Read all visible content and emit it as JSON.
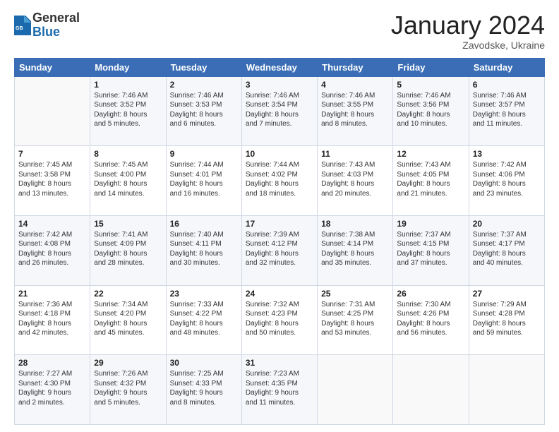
{
  "header": {
    "logo_general": "General",
    "logo_blue": "Blue",
    "month_title": "January 2024",
    "subtitle": "Zavodske, Ukraine"
  },
  "days_of_week": [
    "Sunday",
    "Monday",
    "Tuesday",
    "Wednesday",
    "Thursday",
    "Friday",
    "Saturday"
  ],
  "weeks": [
    [
      {
        "num": "",
        "info": ""
      },
      {
        "num": "1",
        "info": "Sunrise: 7:46 AM\nSunset: 3:52 PM\nDaylight: 8 hours\nand 5 minutes."
      },
      {
        "num": "2",
        "info": "Sunrise: 7:46 AM\nSunset: 3:53 PM\nDaylight: 8 hours\nand 6 minutes."
      },
      {
        "num": "3",
        "info": "Sunrise: 7:46 AM\nSunset: 3:54 PM\nDaylight: 8 hours\nand 7 minutes."
      },
      {
        "num": "4",
        "info": "Sunrise: 7:46 AM\nSunset: 3:55 PM\nDaylight: 8 hours\nand 8 minutes."
      },
      {
        "num": "5",
        "info": "Sunrise: 7:46 AM\nSunset: 3:56 PM\nDaylight: 8 hours\nand 10 minutes."
      },
      {
        "num": "6",
        "info": "Sunrise: 7:46 AM\nSunset: 3:57 PM\nDaylight: 8 hours\nand 11 minutes."
      }
    ],
    [
      {
        "num": "7",
        "info": "Sunrise: 7:45 AM\nSunset: 3:58 PM\nDaylight: 8 hours\nand 13 minutes."
      },
      {
        "num": "8",
        "info": "Sunrise: 7:45 AM\nSunset: 4:00 PM\nDaylight: 8 hours\nand 14 minutes."
      },
      {
        "num": "9",
        "info": "Sunrise: 7:44 AM\nSunset: 4:01 PM\nDaylight: 8 hours\nand 16 minutes."
      },
      {
        "num": "10",
        "info": "Sunrise: 7:44 AM\nSunset: 4:02 PM\nDaylight: 8 hours\nand 18 minutes."
      },
      {
        "num": "11",
        "info": "Sunrise: 7:43 AM\nSunset: 4:03 PM\nDaylight: 8 hours\nand 20 minutes."
      },
      {
        "num": "12",
        "info": "Sunrise: 7:43 AM\nSunset: 4:05 PM\nDaylight: 8 hours\nand 21 minutes."
      },
      {
        "num": "13",
        "info": "Sunrise: 7:42 AM\nSunset: 4:06 PM\nDaylight: 8 hours\nand 23 minutes."
      }
    ],
    [
      {
        "num": "14",
        "info": "Sunrise: 7:42 AM\nSunset: 4:08 PM\nDaylight: 8 hours\nand 26 minutes."
      },
      {
        "num": "15",
        "info": "Sunrise: 7:41 AM\nSunset: 4:09 PM\nDaylight: 8 hours\nand 28 minutes."
      },
      {
        "num": "16",
        "info": "Sunrise: 7:40 AM\nSunset: 4:11 PM\nDaylight: 8 hours\nand 30 minutes."
      },
      {
        "num": "17",
        "info": "Sunrise: 7:39 AM\nSunset: 4:12 PM\nDaylight: 8 hours\nand 32 minutes."
      },
      {
        "num": "18",
        "info": "Sunrise: 7:38 AM\nSunset: 4:14 PM\nDaylight: 8 hours\nand 35 minutes."
      },
      {
        "num": "19",
        "info": "Sunrise: 7:37 AM\nSunset: 4:15 PM\nDaylight: 8 hours\nand 37 minutes."
      },
      {
        "num": "20",
        "info": "Sunrise: 7:37 AM\nSunset: 4:17 PM\nDaylight: 8 hours\nand 40 minutes."
      }
    ],
    [
      {
        "num": "21",
        "info": "Sunrise: 7:36 AM\nSunset: 4:18 PM\nDaylight: 8 hours\nand 42 minutes."
      },
      {
        "num": "22",
        "info": "Sunrise: 7:34 AM\nSunset: 4:20 PM\nDaylight: 8 hours\nand 45 minutes."
      },
      {
        "num": "23",
        "info": "Sunrise: 7:33 AM\nSunset: 4:22 PM\nDaylight: 8 hours\nand 48 minutes."
      },
      {
        "num": "24",
        "info": "Sunrise: 7:32 AM\nSunset: 4:23 PM\nDaylight: 8 hours\nand 50 minutes."
      },
      {
        "num": "25",
        "info": "Sunrise: 7:31 AM\nSunset: 4:25 PM\nDaylight: 8 hours\nand 53 minutes."
      },
      {
        "num": "26",
        "info": "Sunrise: 7:30 AM\nSunset: 4:26 PM\nDaylight: 8 hours\nand 56 minutes."
      },
      {
        "num": "27",
        "info": "Sunrise: 7:29 AM\nSunset: 4:28 PM\nDaylight: 8 hours\nand 59 minutes."
      }
    ],
    [
      {
        "num": "28",
        "info": "Sunrise: 7:27 AM\nSunset: 4:30 PM\nDaylight: 9 hours\nand 2 minutes."
      },
      {
        "num": "29",
        "info": "Sunrise: 7:26 AM\nSunset: 4:32 PM\nDaylight: 9 hours\nand 5 minutes."
      },
      {
        "num": "30",
        "info": "Sunrise: 7:25 AM\nSunset: 4:33 PM\nDaylight: 9 hours\nand 8 minutes."
      },
      {
        "num": "31",
        "info": "Sunrise: 7:23 AM\nSunset: 4:35 PM\nDaylight: 9 hours\nand 11 minutes."
      },
      {
        "num": "",
        "info": ""
      },
      {
        "num": "",
        "info": ""
      },
      {
        "num": "",
        "info": ""
      }
    ]
  ]
}
